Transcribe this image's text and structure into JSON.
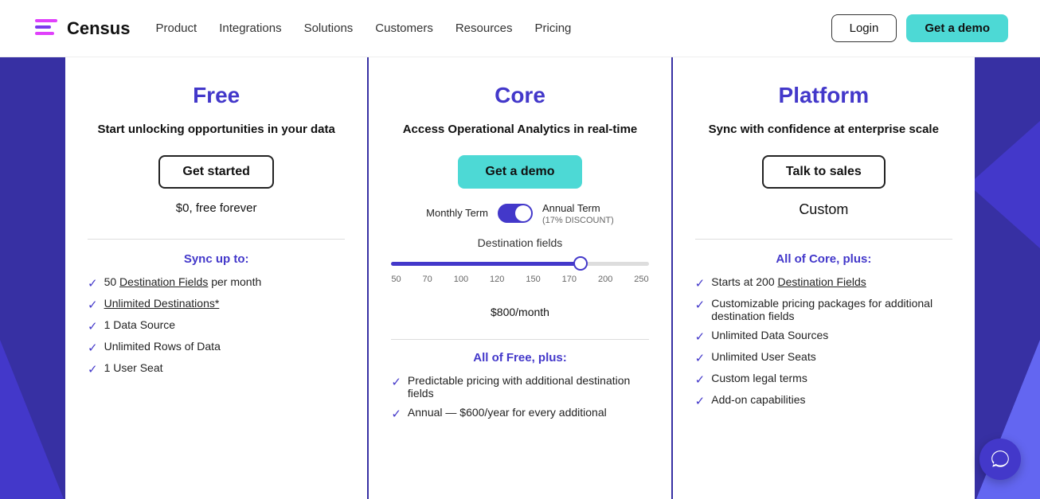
{
  "nav": {
    "logo_text": "Census",
    "links": [
      {
        "label": "Product",
        "id": "product"
      },
      {
        "label": "Integrations",
        "id": "integrations"
      },
      {
        "label": "Solutions",
        "id": "solutions"
      },
      {
        "label": "Customers",
        "id": "customers"
      },
      {
        "label": "Resources",
        "id": "resources"
      },
      {
        "label": "Pricing",
        "id": "pricing"
      }
    ],
    "login_label": "Login",
    "demo_label": "Get a demo"
  },
  "pricing": {
    "plans": [
      {
        "id": "free",
        "title": "Free",
        "desc": "Start unlocking opportunities in your data",
        "cta": "Get started",
        "price": "$0, free forever",
        "features_title": "Sync up to:",
        "features": [
          "50 Destination Fields per month",
          "Unlimited Destinations*",
          "1 Data Source",
          "Unlimited Rows of Data",
          "1 User Seat"
        ]
      },
      {
        "id": "core",
        "title": "Core",
        "desc": "Access Operational Analytics in real-time",
        "cta": "Get a demo",
        "toggle": {
          "monthly_label": "Monthly Term",
          "annual_label": "Annual Term",
          "discount": "17% DISCOUNT"
        },
        "slider": {
          "label": "Destination fields",
          "ticks": [
            "50",
            "70",
            "100",
            "120",
            "150",
            "170",
            "200",
            "250"
          ],
          "value": 200
        },
        "price": "$800",
        "price_period": "/month",
        "features_title": "All of Free, plus:",
        "features": [
          "Predictable pricing with additional destination fields",
          "Annual — $600/year for every additional"
        ]
      },
      {
        "id": "platform",
        "title": "Platform",
        "desc": "Sync with confidence at enterprise scale",
        "cta": "Talk to sales",
        "price": "Custom",
        "features_title": "All of Core, plus:",
        "features": [
          "Starts at 200 Destination Fields",
          "Customizable pricing packages for additional destination fields",
          "Unlimited Data Sources",
          "Unlimited User Seats",
          "Custom legal terms",
          "Add-on capabilities"
        ]
      }
    ]
  }
}
